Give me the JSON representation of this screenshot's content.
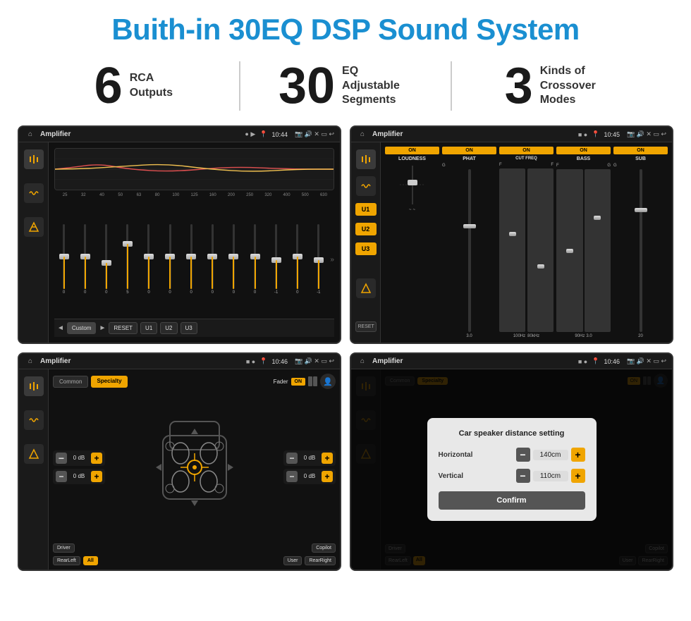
{
  "page": {
    "title": "Buith-in 30EQ DSP Sound System",
    "background": "#ffffff"
  },
  "stats": [
    {
      "number": "6",
      "label": "RCA\nOutputs"
    },
    {
      "number": "30",
      "label": "EQ Adjustable\nSegments"
    },
    {
      "number": "3",
      "label": "Kinds of\nCrossover Modes"
    }
  ],
  "screens": {
    "eq": {
      "title": "Amplifier",
      "time": "10:44",
      "preset": "Custom",
      "freq_labels": [
        "25",
        "32",
        "40",
        "50",
        "63",
        "80",
        "100",
        "125",
        "160",
        "200",
        "250",
        "320",
        "400",
        "500",
        "630"
      ],
      "slider_values": [
        "0",
        "0",
        "0",
        "5",
        "0",
        "0",
        "0",
        "0",
        "0",
        "0",
        "-1",
        "0",
        "-1"
      ],
      "buttons": [
        "Custom",
        "RESET",
        "U1",
        "U2",
        "U3"
      ]
    },
    "crossover": {
      "title": "Amplifier",
      "time": "10:45",
      "channels": [
        {
          "name": "LOUDNESS",
          "on": true
        },
        {
          "name": "PHAT",
          "on": true
        },
        {
          "name": "CUT FREQ",
          "on": true
        },
        {
          "name": "BASS",
          "on": true
        },
        {
          "name": "SUB",
          "on": true
        }
      ],
      "presets": [
        "U1",
        "U2",
        "U3"
      ]
    },
    "fader": {
      "title": "Amplifier",
      "time": "10:46",
      "tabs": [
        "Common",
        "Specialty"
      ],
      "active_tab": "Specialty",
      "fader_label": "Fader",
      "on_btn": "ON",
      "controls": [
        {
          "label": "0 dB"
        },
        {
          "label": "0 dB"
        },
        {
          "label": "0 dB"
        },
        {
          "label": "0 dB"
        }
      ],
      "position_labels": [
        "Driver",
        "RearLeft",
        "All",
        "Copilot",
        "RearRight",
        "User"
      ]
    },
    "dialog": {
      "title": "Amplifier",
      "time": "10:46",
      "tabs": [
        "Common",
        "Specialty"
      ],
      "modal_title": "Car speaker distance setting",
      "fields": [
        {
          "label": "Horizontal",
          "value": "140cm"
        },
        {
          "label": "Vertical",
          "value": "110cm"
        }
      ],
      "confirm_btn": "Confirm",
      "position_labels": [
        "Driver",
        "RearLeft",
        "All",
        "Copilot",
        "RearRight",
        "User"
      ]
    }
  }
}
